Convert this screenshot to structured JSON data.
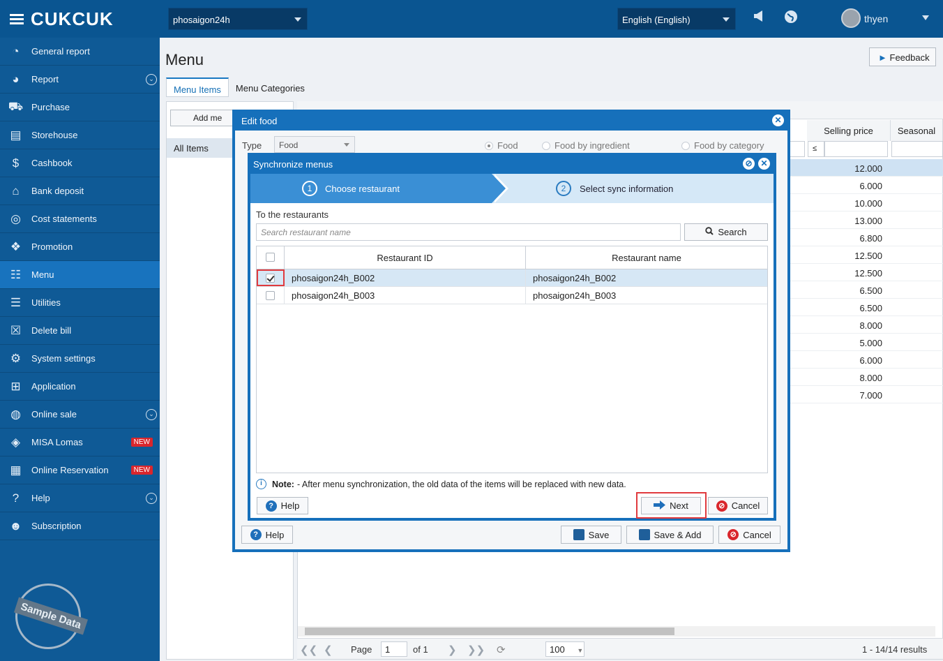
{
  "app": {
    "logo": "CUKCUK",
    "restaurant_select": "phosaigon24h",
    "language_select": "English (English)",
    "username": "thyen"
  },
  "sidebar": {
    "items": [
      {
        "label": "General report",
        "icon": "dashboard-icon"
      },
      {
        "label": "Report",
        "icon": "pie-chart-icon",
        "expandable": true
      },
      {
        "label": "Purchase",
        "icon": "cart-icon"
      },
      {
        "label": "Storehouse",
        "icon": "warehouse-icon"
      },
      {
        "label": "Cashbook",
        "icon": "dollar-icon"
      },
      {
        "label": "Bank deposit",
        "icon": "bank-icon"
      },
      {
        "label": "Cost statements",
        "icon": "money-bag-icon"
      },
      {
        "label": "Promotion",
        "icon": "gift-icon"
      },
      {
        "label": "Menu",
        "icon": "clipboard-icon",
        "active": true
      },
      {
        "label": "Utilities",
        "icon": "list-icon"
      },
      {
        "label": "Delete bill",
        "icon": "delete-bill-icon"
      },
      {
        "label": "System settings",
        "icon": "gear-icon"
      },
      {
        "label": "Application",
        "icon": "apps-icon"
      },
      {
        "label": "Online sale",
        "icon": "globe-icon",
        "expandable": true
      },
      {
        "label": "MISA Lomas",
        "icon": "layers-icon",
        "badge": "NEW"
      },
      {
        "label": "Online Reservation",
        "icon": "reservation-icon",
        "badge": "NEW"
      },
      {
        "label": "Help",
        "icon": "help-icon",
        "expandable": true
      },
      {
        "label": "Subscription",
        "icon": "users-icon"
      }
    ],
    "stamp": "Sample Data"
  },
  "main": {
    "title": "Menu",
    "feedback": "Feedback",
    "tabs": [
      "Menu Items",
      "Menu Categories"
    ],
    "add_button": "Add me",
    "all_items": "All Items",
    "columns": {
      "selling_price": "Selling price",
      "seasonal": "Seasonal"
    },
    "filter_op": "≤",
    "prices": [
      "12.000",
      "6.000",
      "10.000",
      "13.000",
      "6.800",
      "12.500",
      "12.500",
      "6.500",
      "6.500",
      "8.000",
      "5.000",
      "6.000",
      "8.000",
      "7.000"
    ],
    "pager": {
      "page_label": "Page",
      "page": "1",
      "of": "of 1",
      "page_size": "100",
      "results": "1 - 14/14 results"
    }
  },
  "edit_food": {
    "title": "Edit food",
    "type_label": "Type",
    "type_value": "Food",
    "radios": [
      "Food",
      "Food by ingredient",
      "Food by category"
    ],
    "help": "Help",
    "save": "Save",
    "save_add": "Save & Add",
    "cancel": "Cancel"
  },
  "sync": {
    "title": "Synchronize menus",
    "steps": [
      {
        "num": "1",
        "label": "Choose restaurant"
      },
      {
        "num": "2",
        "label": "Select sync information"
      }
    ],
    "to_label": "To the restaurants",
    "search_placeholder": "Search restaurant name",
    "search_btn": "Search",
    "headers": [
      "Restaurant ID",
      "Restaurant name"
    ],
    "rows": [
      {
        "id": "phosaigon24h_B002",
        "name": "phosaigon24h_B002",
        "checked": true
      },
      {
        "id": "phosaigon24h_B003",
        "name": "phosaigon24h_B003",
        "checked": false
      }
    ],
    "note_label": "Note:",
    "note_text": "- After menu synchronization, the old data of the items will be replaced with new data.",
    "help": "Help",
    "next": "Next",
    "cancel": "Cancel"
  }
}
